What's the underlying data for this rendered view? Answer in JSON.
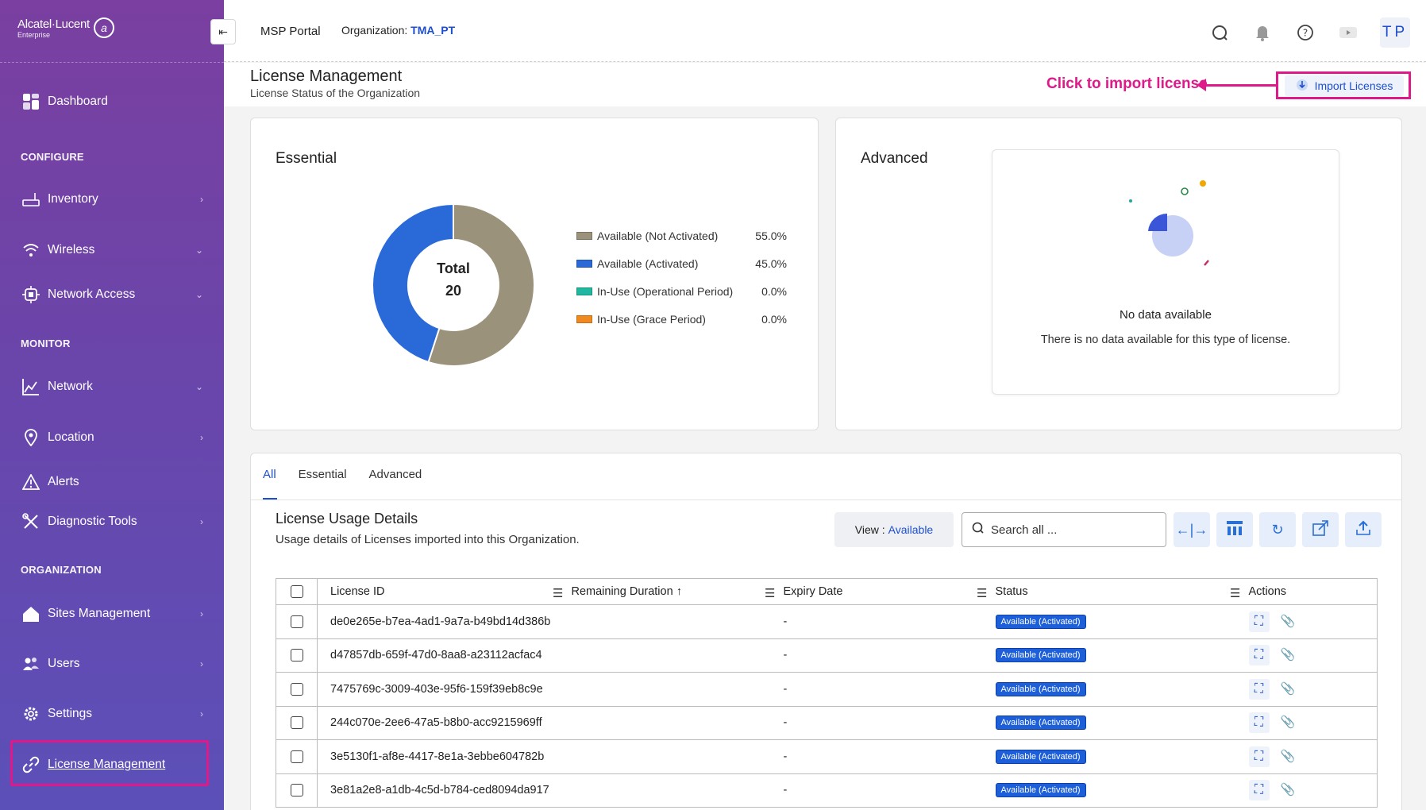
{
  "sidebar": {
    "brand": "Alcatel·Lucent",
    "brand_sub": "Enterprise",
    "items": [
      {
        "label": "Dashboard"
      },
      {
        "label": "Inventory"
      },
      {
        "label": "Wireless"
      },
      {
        "label": "Network Access"
      },
      {
        "label": "Network"
      },
      {
        "label": "Location"
      },
      {
        "label": "Alerts"
      },
      {
        "label": "Diagnostic Tools"
      },
      {
        "label": "Sites Management"
      },
      {
        "label": "Users"
      },
      {
        "label": "Settings"
      },
      {
        "label": "License Management"
      }
    ],
    "sections": [
      "CONFIGURE",
      "MONITOR",
      "ORGANIZATION"
    ]
  },
  "topbar": {
    "portal": "MSP Portal",
    "org_label": "Organization:",
    "org_value": "TMA_PT",
    "avatar": "TP"
  },
  "page": {
    "title": "License Management",
    "subtitle": "License Status of the Organization",
    "callout": "Click to import license",
    "import_label": "Import Licenses"
  },
  "essential": {
    "title": "Essential",
    "total_label": "Total",
    "total_value": "20",
    "legend": [
      {
        "label": "Available (Not Activated)",
        "pct": "55.0%",
        "color": "#9b927c"
      },
      {
        "label": "Available (Activated)",
        "pct": "45.0%",
        "color": "#2a6ad8"
      },
      {
        "label": "In-Use (Operational Period)",
        "pct": "0.0%",
        "color": "#20b8a0"
      },
      {
        "label": "In-Use (Grace Period)",
        "pct": "0.0%",
        "color": "#f08a20"
      }
    ]
  },
  "chart_data": {
    "type": "pie",
    "categories": [
      "Available (Not Activated)",
      "Available (Activated)",
      "In-Use (Operational Period)",
      "In-Use (Grace Period)"
    ],
    "values": [
      55.0,
      45.0,
      0.0,
      0.0
    ],
    "colors": [
      "#9b927c",
      "#2a6ad8",
      "#20b8a0",
      "#f08a20"
    ],
    "title": "Essential",
    "legend": "right"
  },
  "advanced": {
    "title": "Advanced",
    "empty_title": "No data available",
    "empty_text": "There is no data available for this type of license."
  },
  "details": {
    "tabs": [
      "All",
      "Essential",
      "Advanced"
    ],
    "title": "License Usage Details",
    "subtitle": "Usage details of Licenses imported into this Organization.",
    "view_label": "View :",
    "view_value": "Available",
    "search_placeholder": "Search all ...",
    "columns": [
      "License ID",
      "Remaining Duration",
      "Expiry Date",
      "Status",
      "Actions"
    ],
    "rows": [
      {
        "id": "de0e265e-b7ea-4ad1-9a7a-b49bd14d386b",
        "expiry": "-",
        "status": "Available (Activated)"
      },
      {
        "id": "d47857db-659f-47d0-8aa8-a23112acfac4",
        "expiry": "-",
        "status": "Available (Activated)"
      },
      {
        "id": "7475769c-3009-403e-95f6-159f39eb8c9e",
        "expiry": "-",
        "status": "Available (Activated)"
      },
      {
        "id": "244c070e-2ee6-47a5-b8b0-acc9215969ff",
        "expiry": "-",
        "status": "Available (Activated)"
      },
      {
        "id": "3e5130f1-af8e-4417-8e1a-3ebbe604782b",
        "expiry": "-",
        "status": "Available (Activated)"
      },
      {
        "id": "3e81a2e8-a1db-4c5d-b784-ced8094da917",
        "expiry": "-",
        "status": "Available (Activated)"
      }
    ]
  }
}
